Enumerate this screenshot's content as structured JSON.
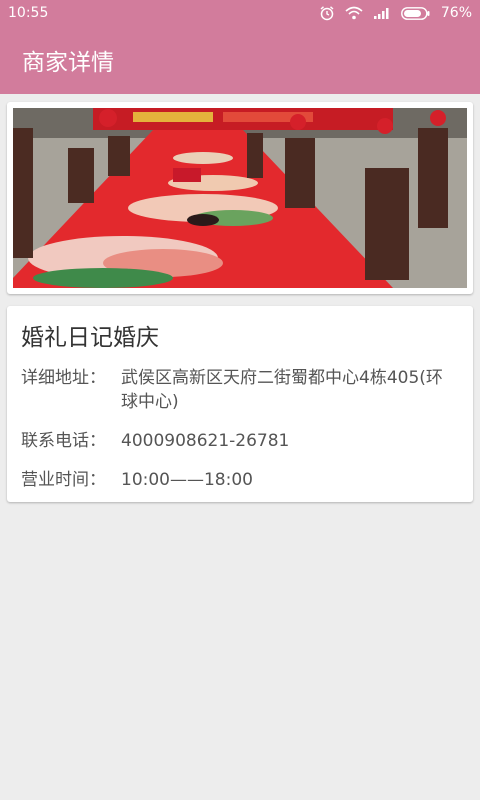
{
  "status_bar": {
    "time": "10:55",
    "battery": "76%",
    "icons": [
      "alarm-icon",
      "wifi-icon",
      "signal-icon",
      "battery-icon"
    ]
  },
  "app_bar": {
    "title": "商家详情"
  },
  "merchant": {
    "name": "婚礼日记婚庆",
    "address_label": "详细地址：",
    "address_value": "武侯区高新区天府二街蜀都中心4栋405(环球中心)",
    "phone_label": "联系电话：",
    "phone_value": "4000908621-26781",
    "hours_label": "营业时间：",
    "hours_value": "10:00——18:00"
  },
  "colors": {
    "primary": "#d27c9c",
    "background": "#ededed"
  }
}
